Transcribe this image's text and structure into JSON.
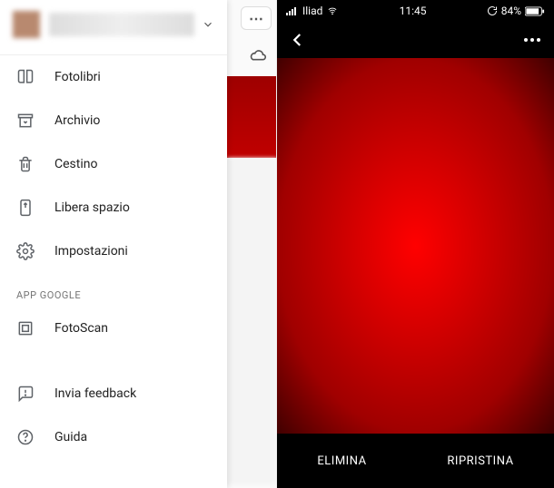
{
  "left": {
    "menu": {
      "fotolibri": "Fotolibri",
      "archivio": "Archivio",
      "cestino": "Cestino",
      "libera_spazio": "Libera spazio",
      "impostazioni": "Impostazioni",
      "fotoscan": "FotoScan",
      "invia_feedback": "Invia feedback",
      "guida": "Guida"
    },
    "section_label": "APP GOOGLE"
  },
  "right": {
    "status": {
      "carrier": "Iliad",
      "time": "11:45",
      "battery": "84%"
    },
    "actions": {
      "elimina": "ELIMINA",
      "ripristina": "RIPRISTINA"
    }
  }
}
